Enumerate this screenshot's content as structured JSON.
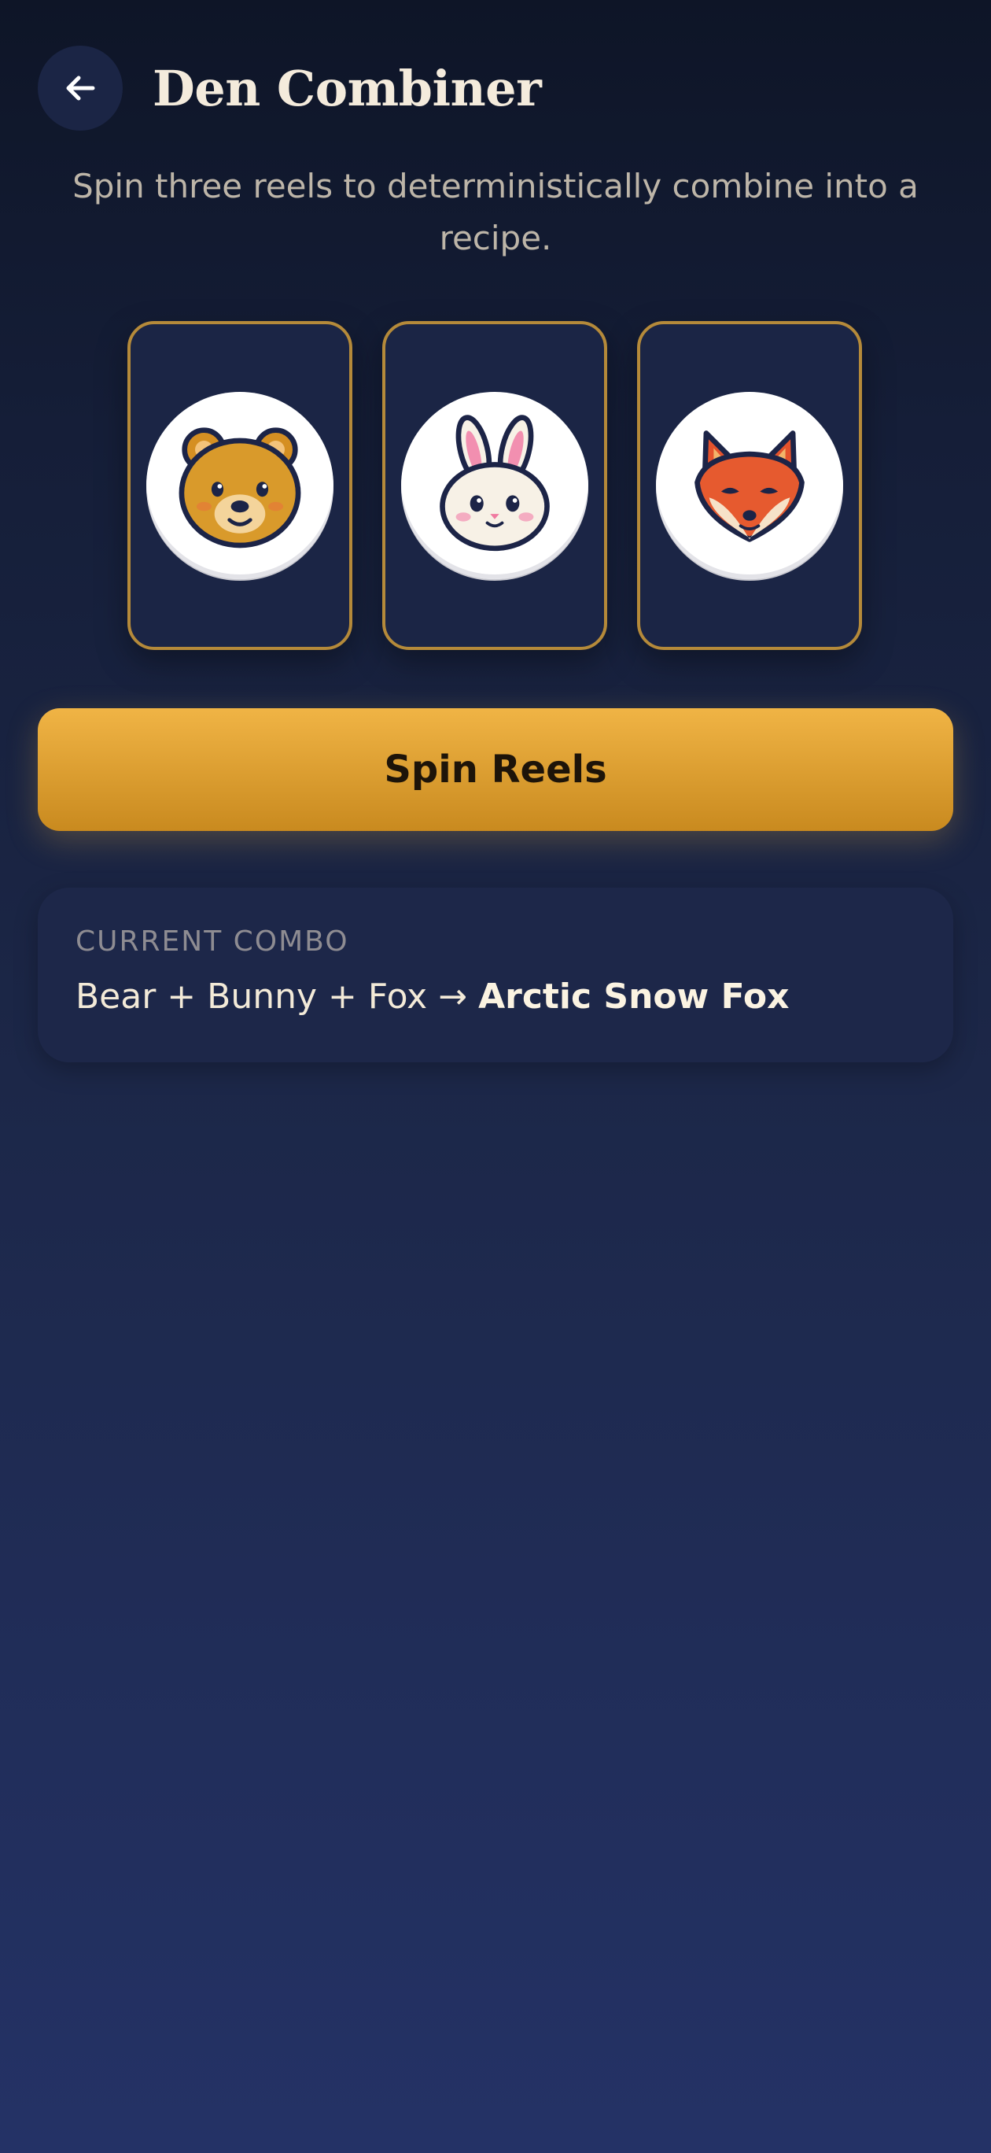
{
  "header": {
    "title": "Den Combiner",
    "back_icon": "arrow-left-icon"
  },
  "subtitle": "Spin three reels to deterministically combine into a recipe.",
  "reels": [
    {
      "animal": "Bear",
      "icon": "bear-icon"
    },
    {
      "animal": "Bunny",
      "icon": "bunny-icon"
    },
    {
      "animal": "Fox",
      "icon": "fox-icon"
    }
  ],
  "spin_button": {
    "label": "Spin Reels"
  },
  "combo": {
    "label": "CURRENT COMBO",
    "formula": "Bear + Bunny + Fox → ",
    "result": "Arctic Snow Fox"
  },
  "colors": {
    "accent": "#f0b445",
    "reel_border": "#b58a3a",
    "card_bg": "#1d2749",
    "background_top": "#0e1527",
    "background_bottom": "#243266"
  }
}
